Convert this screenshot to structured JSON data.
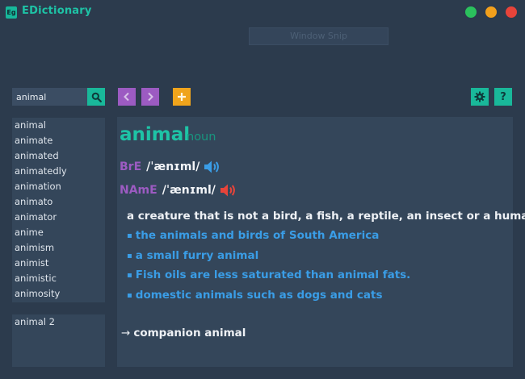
{
  "app": {
    "title": "EDictionary",
    "logo_text": "Eg"
  },
  "snip_overlay": {
    "label": "Window Snip"
  },
  "search": {
    "value": "animal"
  },
  "toolbar": {
    "back_icon": "chevron-left-icon",
    "forward_icon": "chevron-right-icon",
    "add_icon": "plus-icon",
    "settings_icon": "gear-icon",
    "help_label": "?"
  },
  "word_list": [
    "animal",
    "animate",
    "animated",
    "animatedly",
    "animation",
    "animato",
    "animator",
    "anime",
    "animism",
    "animist",
    "animistic",
    "animosity"
  ],
  "sub_list": [
    "animal 2"
  ],
  "entry": {
    "headword": "animal",
    "pos": "noun",
    "bre_label": "BrE",
    "bre_ipa": "/ˈænɪml/",
    "name_label": "NAmE",
    "name_ipa": "/ˈænɪml/",
    "definition": "a creature that is not a bird, a fish, a reptile, an insect or a human",
    "examples": [
      "the animals and birds of South America",
      "a small furry animal",
      "Fish oils are less saturated than animal fats.",
      "domestic animals such as dogs and cats"
    ],
    "related_arrow": "→",
    "related": "companion animal"
  },
  "colors": {
    "background": "#2c3b4d",
    "panel": "#34465a",
    "teal": "#1ec3a6",
    "purple": "#9c5bc2",
    "orange": "#f0a41c",
    "blue": "#3a9de6",
    "red_speaker": "#e7443a"
  }
}
